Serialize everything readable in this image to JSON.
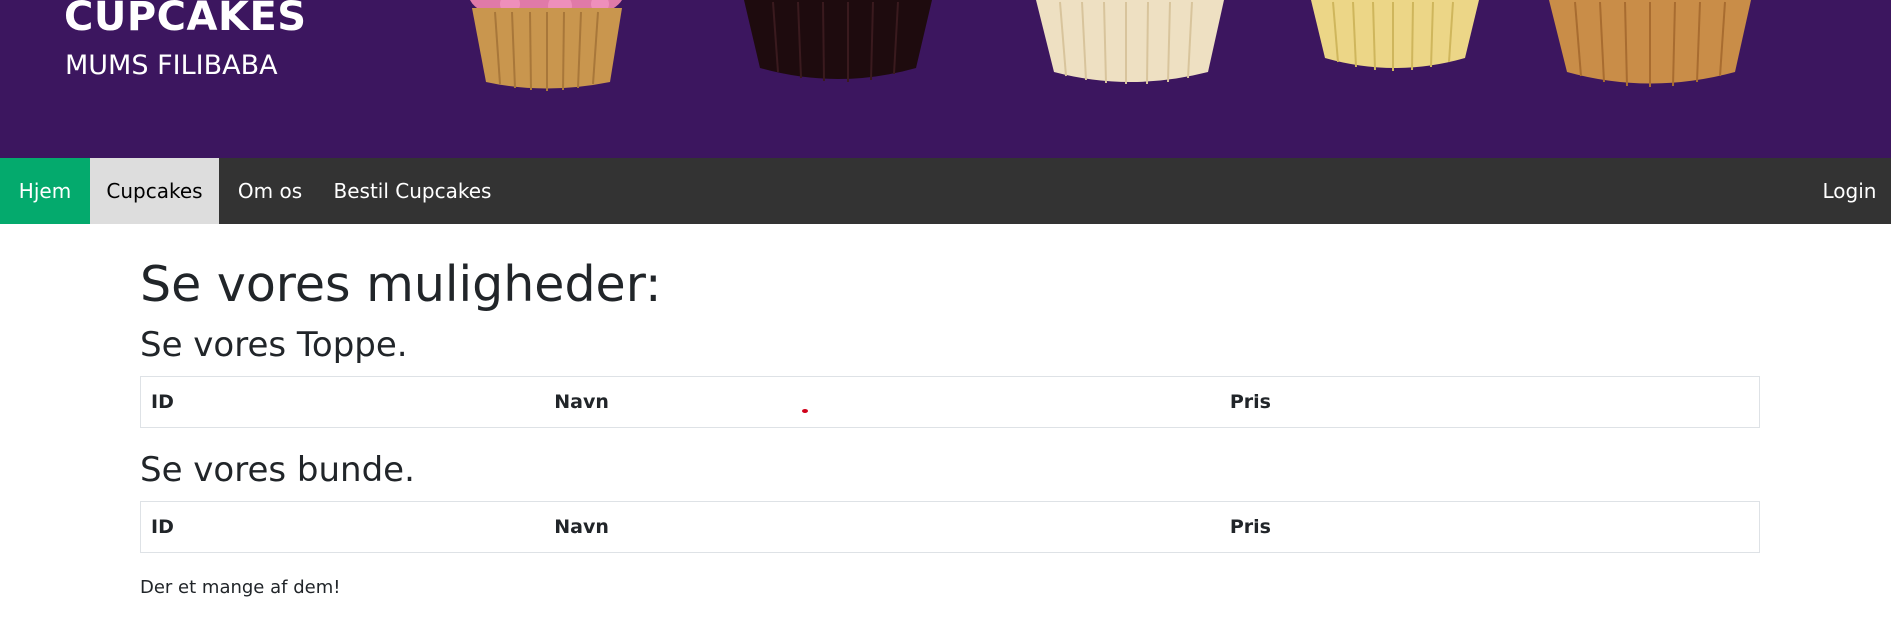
{
  "banner": {
    "title": "CUPCAKES",
    "subtitle": "MUMS FILIBABA",
    "background_color": "#3c165f",
    "cupcakes": [
      {
        "name": "pink-frosted-cupcake",
        "liner": "#c9964e",
        "top": "#e07aa8"
      },
      {
        "name": "chocolate-cupcake",
        "liner": "#1e0b0e",
        "top": "#2a1214"
      },
      {
        "name": "vanilla-cupcake",
        "liner": "#eee0c2",
        "top": "#f7efdc"
      },
      {
        "name": "lemon-cupcake",
        "liner": "#ecd687",
        "top": "#f5e5a7"
      },
      {
        "name": "caramel-cupcake",
        "liner": "#c98d48",
        "top": "#ddb07a"
      }
    ]
  },
  "nav": {
    "home": "Hjem",
    "cupcakes": "Cupcakes",
    "about": "Om os",
    "order": "Bestil Cupcakes",
    "login": "Login",
    "active_color": "#04aa6d",
    "selected_color": "#dddddd",
    "bar_color": "#333333"
  },
  "main": {
    "heading": "Se vores muligheder:",
    "toppings": {
      "heading": "Se vores Toppe.",
      "columns": [
        "ID",
        "Navn",
        "Pris"
      ]
    },
    "bottoms": {
      "heading": "Se vores bunde.",
      "columns": [
        "ID",
        "Navn",
        "Pris"
      ]
    },
    "footnote": "Der et mange af dem!"
  }
}
